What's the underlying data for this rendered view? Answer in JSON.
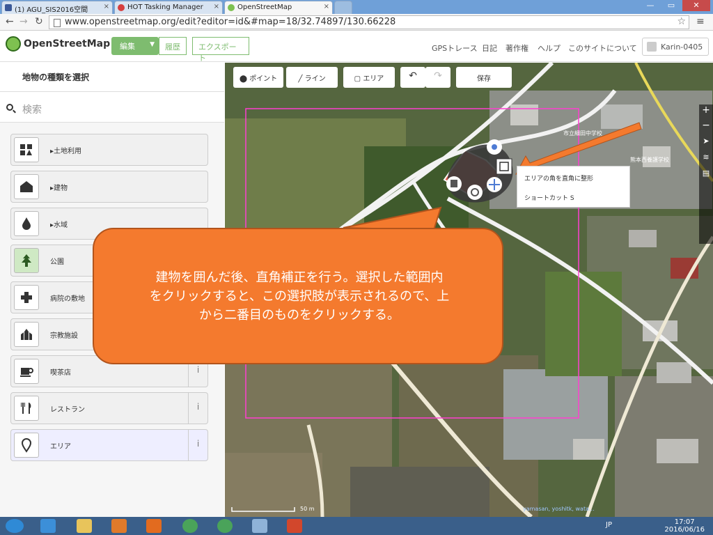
{
  "browser": {
    "tabs": [
      {
        "label": "(1) AGU_SIS2016空間"
      },
      {
        "label": "HOT Tasking Manager"
      },
      {
        "label": "OpenStreetMap"
      }
    ],
    "url": "www.openstreetmap.org/edit?editor=id&#map=18/32.74897/130.66228"
  },
  "header": {
    "logo": "OpenStreetMap",
    "edit_label": "編集",
    "history_label": "履歴",
    "export_label": "エクスポート",
    "links": [
      "GPSトレース",
      "日記",
      "著作権",
      "ヘルプ",
      "このサイトについて"
    ],
    "user": "Karin-0405"
  },
  "sidebar": {
    "title": "地物の種類を選択",
    "search_placeholder": "検索",
    "presets": [
      {
        "label": "▸土地利用",
        "icon": "landuse-icon"
      },
      {
        "label": "▸建物",
        "icon": "building-icon"
      },
      {
        "label": "▸水域",
        "icon": "water-icon"
      },
      {
        "label": "公園",
        "icon": "park-icon"
      },
      {
        "label": "病院の敷地",
        "icon": "hospital-icon"
      },
      {
        "label": "宗教施設",
        "icon": "religious-icon"
      },
      {
        "label": "喫茶店",
        "icon": "cafe-icon"
      },
      {
        "label": "レストラン",
        "icon": "restaurant-icon"
      },
      {
        "label": "エリア",
        "icon": "area-icon"
      }
    ],
    "info_glyph": "i"
  },
  "toolbar": {
    "point": "ポイント",
    "line": "ライン",
    "area": "エリア",
    "save": "保存"
  },
  "map": {
    "tooltip_line1": "エリアの角を直角に整形",
    "tooltip_line2": "ショートカット S",
    "label_a": "市立細田中学校",
    "label_b": "熊本西養護学校",
    "scale": "50 m",
    "attribution": "yamasan, yoshitk, wata..."
  },
  "callout": {
    "lines": [
      "建物を囲んだ後、直角補正を行う。選択した範囲内",
      "をクリックすると、この選択肢が表示されるので、上",
      "から二番目のものをクリックする。"
    ]
  },
  "taskbar": {
    "lang": "JP",
    "time": "17:07",
    "date": "2016/06/16"
  },
  "colors": {
    "osm_green": "#7ebc6f",
    "callout_orange": "#f47a2e"
  }
}
